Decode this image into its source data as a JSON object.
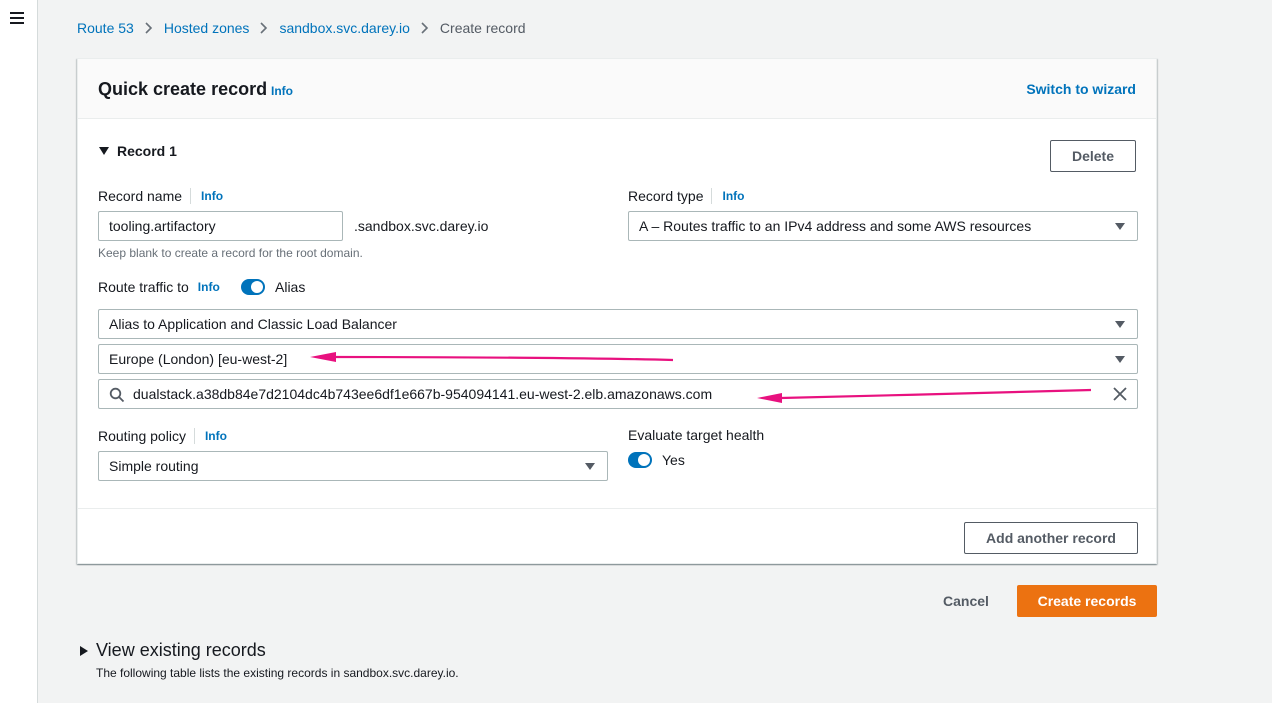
{
  "breadcrumb": {
    "items": [
      "Route 53",
      "Hosted zones",
      "sandbox.svc.darey.io"
    ],
    "current": "Create record"
  },
  "card": {
    "title": "Quick create record",
    "title_info": "Info",
    "switch_link": "Switch to wizard"
  },
  "record": {
    "heading": "Record 1",
    "delete_label": "Delete",
    "name_label": "Record name",
    "name_info": "Info",
    "name_value": "tooling.artifactory",
    "domain_suffix": ".sandbox.svc.darey.io",
    "name_hint": "Keep blank to create a record for the root domain.",
    "type_label": "Record type",
    "type_info": "Info",
    "type_value": "A – Routes traffic to an IPv4 address and some AWS resources",
    "route_label": "Route traffic to",
    "route_info": "Info",
    "alias_label": "Alias",
    "alias_target": "Alias to Application and Classic Load Balancer",
    "region": "Europe (London) [eu-west-2]",
    "endpoint": "dualstack.a38db84e7d2104dc4b743ee6df1e667b-954094141.eu-west-2.elb.amazonaws.com",
    "policy_label": "Routing policy",
    "policy_info": "Info",
    "policy_value": "Simple routing",
    "health_label": "Evaluate target health",
    "health_value": "Yes"
  },
  "footer": {
    "add_label": "Add another record",
    "cancel_label": "Cancel",
    "create_label": "Create records"
  },
  "existing": {
    "heading": "View existing records",
    "description": "The following table lists the existing records in sandbox.svc.darey.io."
  },
  "colors": {
    "accent": "#0073bb",
    "primary_button": "#ec7211",
    "annotation_arrow": "#e8117f"
  }
}
